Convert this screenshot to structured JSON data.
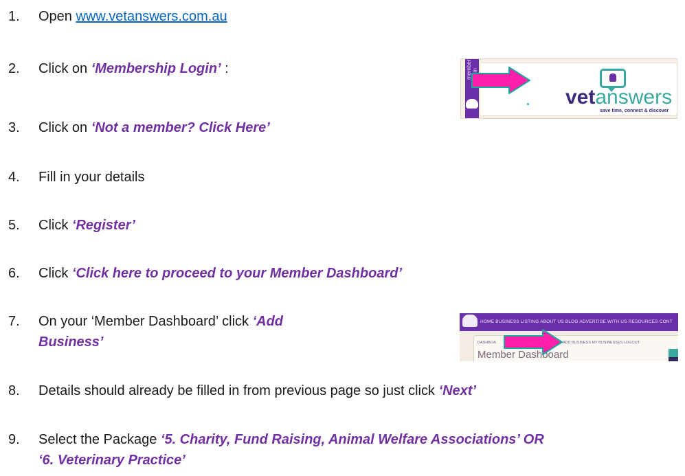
{
  "steps": [
    {
      "num": "1.",
      "pre": "Open ",
      "link": "www.vetanswers.com.au"
    },
    {
      "num": "2.",
      "pre": "Click on ",
      "em": "‘Membership Login’",
      "post": " :"
    },
    {
      "num": "3.",
      "pre": "Click on ",
      "em": "‘Not a member? Click Here’"
    },
    {
      "num": "4.",
      "pre": "Fill in your details"
    },
    {
      "num": "5.",
      "pre": "Click ",
      "em": "‘Register’"
    },
    {
      "num": "6.",
      "pre": "Click ",
      "em": "‘Click here to proceed to your Member Dashboard’"
    },
    {
      "num": "7.",
      "pre": "On your ‘Member Dashboard’ click ",
      "em": "‘Add",
      "em2": "Business’"
    },
    {
      "num": "8.",
      "pre": "Details should already be filled in from previous page so just click ",
      "em": "‘Next’"
    },
    {
      "num": "9.",
      "pre": "Select the Package ",
      "em": "‘5. Charity, Fund Raising, Animal Welfare Associations’ OR",
      "em2": "‘6. Veterinary Practice’"
    }
  ],
  "shot1": {
    "tab_label_1": "member",
    "tab_label_2": "login",
    "brand_bold": "vet",
    "brand_light": "answers",
    "tagline": "save time, connect & discover"
  },
  "shot2": {
    "menu": "HOME  BUSINESS LISTING  ABOUT US  BLOG  ADVERTISE WITH US  RESOURCES  CONT",
    "subnav_left": "DASHBOA",
    "subnav_right": "ADD BUSINESS   MY BUSINESSES   LOGOUT",
    "title": "Member Dashboard"
  },
  "colors": {
    "emphasis": "#7030a0",
    "link": "#0563c1",
    "arrow_fill": "#ff1fa8",
    "arrow_stroke": "#1aa89a",
    "brand_purple": "#6a2fa8",
    "brand_teal": "#3aa89f"
  },
  "icons": [
    "arrow-right-icon",
    "paw-icon",
    "chat-bubble-icon"
  ]
}
